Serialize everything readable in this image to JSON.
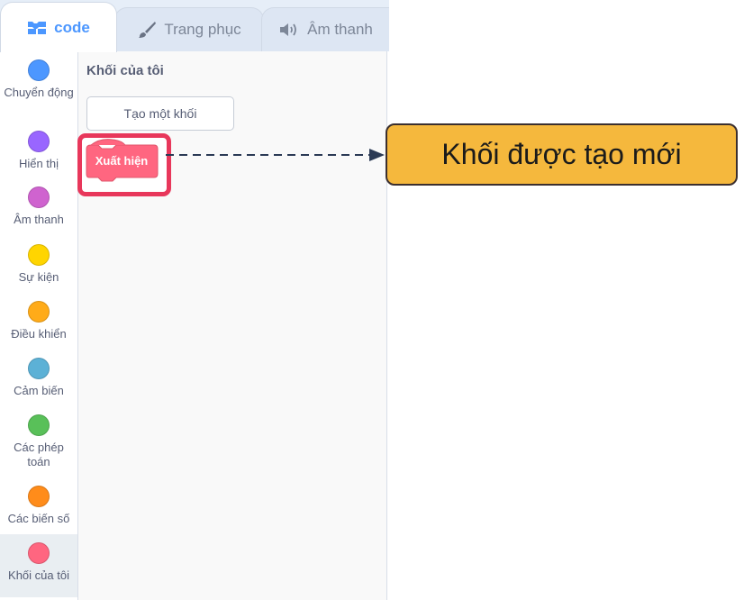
{
  "tabs": [
    {
      "label": "code",
      "icon": "code-blocks-icon"
    },
    {
      "label": "Trang phục",
      "icon": "paintbrush-icon"
    },
    {
      "label": "Âm thanh",
      "icon": "speaker-icon"
    }
  ],
  "categories": [
    {
      "label": "Chuyển động",
      "color": "#4c97ff"
    },
    {
      "label": "Hiển thị",
      "color": "#9966ff"
    },
    {
      "label": "Âm thanh",
      "color": "#cf63cf"
    },
    {
      "label": "Sự kiện",
      "color": "#ffd500"
    },
    {
      "label": "Điều khiển",
      "color": "#ffab19"
    },
    {
      "label": "Cảm biến",
      "color": "#5cb1d6"
    },
    {
      "label": "Các phép toán",
      "color": "#59c059"
    },
    {
      "label": "Các biến số",
      "color": "#ff8c1a"
    },
    {
      "label": "Khối của tôi",
      "color": "#ff6680"
    }
  ],
  "palette": {
    "title": "Khối của tôi",
    "make_block_label": "Tạo một khối",
    "block_label": "Xuất hiện"
  },
  "callout": {
    "text": "Khối được tạo mới"
  },
  "colors": {
    "accent": "#4c97ff",
    "block_fill": "#ff6680",
    "block_border": "#e0556b",
    "highlight": "#e8375b",
    "callout_fill": "#f5b83d",
    "arrow": "#2b3a55"
  }
}
